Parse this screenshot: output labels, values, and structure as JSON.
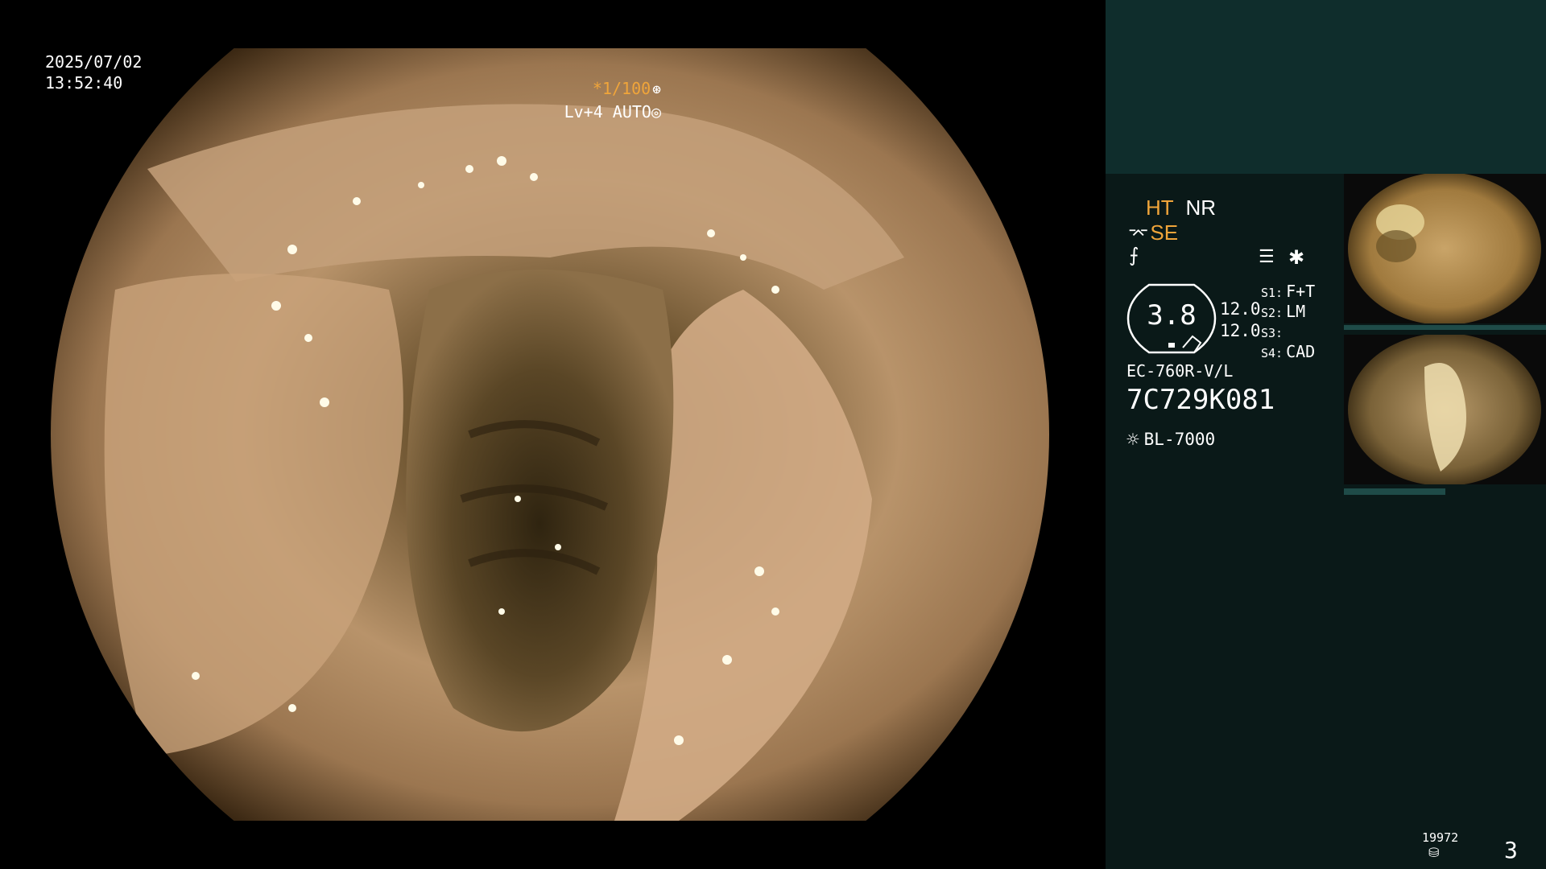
{
  "overlay": {
    "date": "2025/07/02",
    "time": "13:52:40",
    "shutter": "*1/100",
    "iris": "Lv+4 AUTO"
  },
  "panel": {
    "ht": "HT",
    "nr": "NR",
    "se": "SE",
    "gauge_value": "3.8",
    "gauge_sub1": "12.0",
    "gauge_sub2": "12.0",
    "switches": [
      {
        "key": "S1:",
        "value": "F+T"
      },
      {
        "key": "S2:",
        "value": "LM"
      },
      {
        "key": "S3:",
        "value": ""
      },
      {
        "key": "S4:",
        "value": "CAD"
      }
    ],
    "scope_model": "EC-760R-V/L",
    "scope_serial": "7C729K081",
    "light_source": "BL-7000",
    "image_count": "19972",
    "page_number": "3"
  },
  "icons": {
    "shutter": "aperture-icon",
    "iris": "iris-icon",
    "structure_enhance": "se-icon",
    "freeze": "freeze-icon",
    "menu": "list-icon",
    "lamp": "lamp-icon",
    "storage": "disk-icon"
  },
  "colors": {
    "panel_top": "#0f2d2c",
    "panel_bottom": "#0a1918",
    "accent_orange": "#f0a53a"
  }
}
